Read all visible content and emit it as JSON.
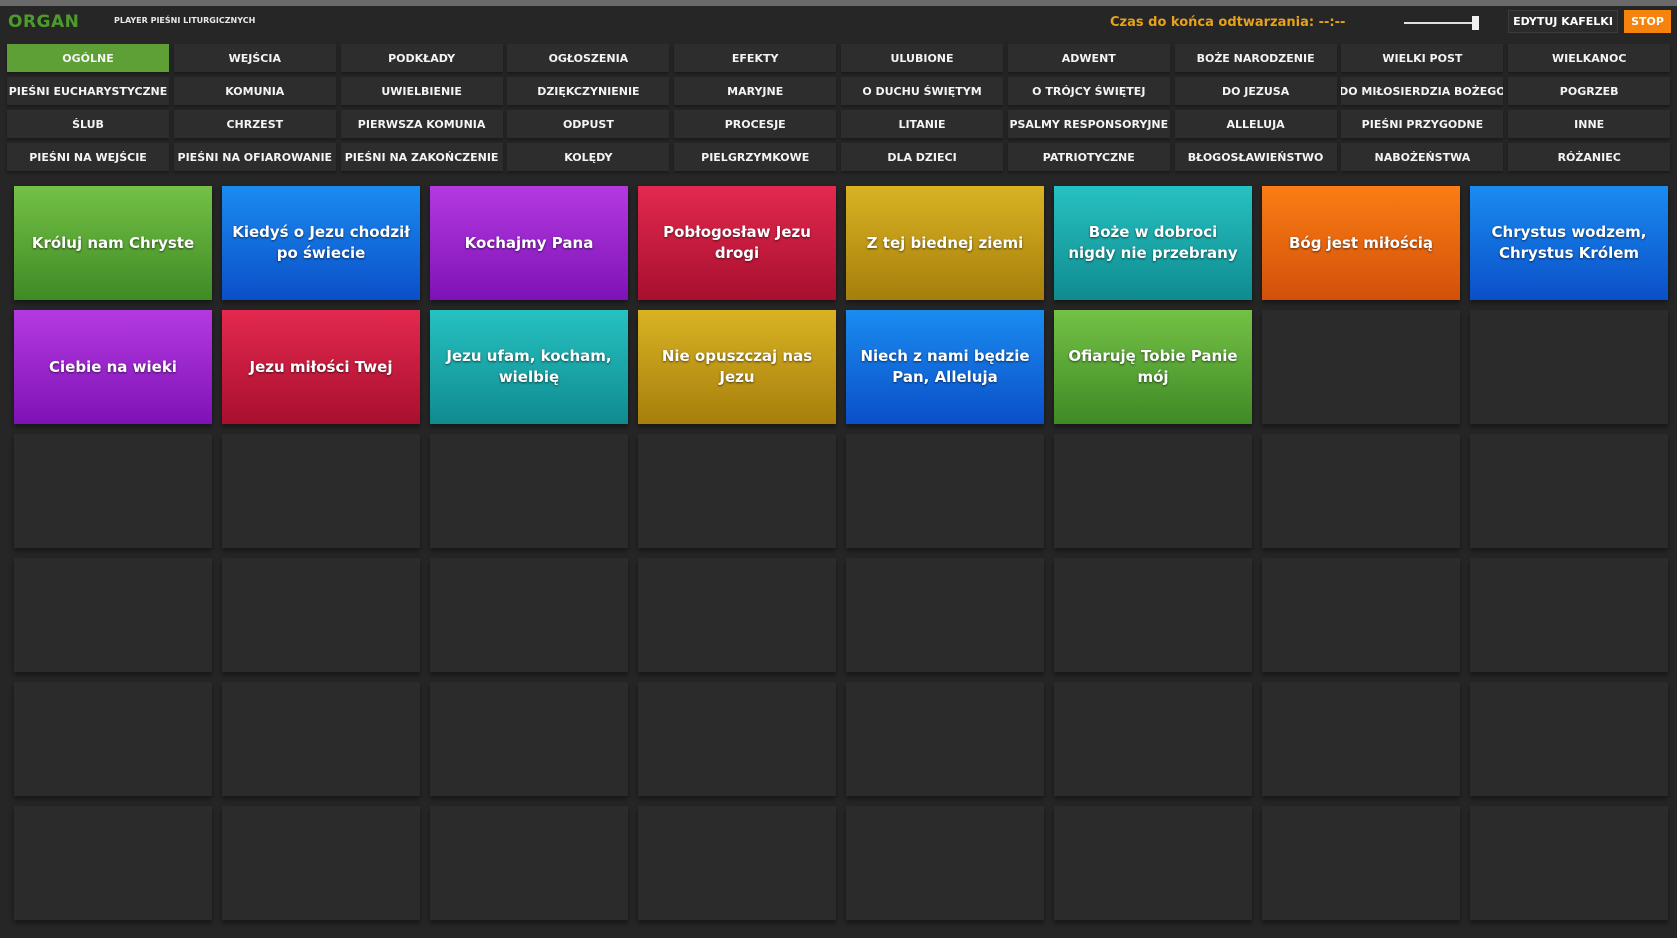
{
  "app": {
    "title": "ORGAN",
    "subtitle": "PLAYER PIEŚNI LITURGICZNYCH",
    "timer_label": "Czas do końca odtwarzania: --:--",
    "edit_button": "EDYTUJ KAFELKI",
    "stop_button": "STOP",
    "accent_color": "#5ea036",
    "timer_color": "#e6a21a",
    "stop_color": "#f5830d"
  },
  "categories": [
    {
      "label": "OGÓLNE",
      "active": true
    },
    {
      "label": "WEJŚCIA"
    },
    {
      "label": "PODKŁADY"
    },
    {
      "label": "OGŁOSZENIA"
    },
    {
      "label": "EFEKTY"
    },
    {
      "label": "ULUBIONE"
    },
    {
      "label": "ADWENT"
    },
    {
      "label": "BOŻE NARODZENIE"
    },
    {
      "label": "WIELKI POST"
    },
    {
      "label": "WIELKANOC"
    },
    {
      "label": "PIEŚNI EUCHARYSTYCZNE"
    },
    {
      "label": "KOMUNIA"
    },
    {
      "label": "UWIELBIENIE"
    },
    {
      "label": "DZIĘKCZYNIENIE"
    },
    {
      "label": "MARYJNE"
    },
    {
      "label": "O DUCHU ŚWIĘTYM"
    },
    {
      "label": "O TRÓJCY ŚWIĘTEJ"
    },
    {
      "label": "DO JEZUSA"
    },
    {
      "label": "DO MIŁOSIERDZIA BOŻEGO"
    },
    {
      "label": "POGRZEB"
    },
    {
      "label": "ŚLUB"
    },
    {
      "label": "CHRZEST"
    },
    {
      "label": "PIERWSZA KOMUNIA"
    },
    {
      "label": "ODPUST"
    },
    {
      "label": "PROCESJE"
    },
    {
      "label": "LITANIE"
    },
    {
      "label": "PSALMY RESPONSORYJNE"
    },
    {
      "label": "ALLELUJA"
    },
    {
      "label": "PIEŚNI PRZYGODNE"
    },
    {
      "label": "INNE"
    },
    {
      "label": "PIEŚNI NA WEJŚCIE"
    },
    {
      "label": "PIEŚNI NA OFIAROWANIE"
    },
    {
      "label": "PIEŚNI NA ZAKOŃCZENIE"
    },
    {
      "label": "KOLĘDY"
    },
    {
      "label": "PIELGRZYMKOWE"
    },
    {
      "label": "DLA DZIECI"
    },
    {
      "label": "PATRIOTYCZNE"
    },
    {
      "label": "BŁOGOSŁAWIEŃSTWO"
    },
    {
      "label": "NABOŻEŃSTWA"
    },
    {
      "label": "RÓŻANIEC"
    }
  ],
  "tiles": [
    {
      "label": "Króluj nam Chryste",
      "color": "green"
    },
    {
      "label": "Kiedyś o Jezu chodził po świecie",
      "color": "blue"
    },
    {
      "label": "Kochajmy Pana",
      "color": "purple"
    },
    {
      "label": "Pobłogosław Jezu drogi",
      "color": "red"
    },
    {
      "label": "Z tej biednej ziemi",
      "color": "gold"
    },
    {
      "label": "Boże w dobroci nigdy nie przebrany",
      "color": "teal"
    },
    {
      "label": "Bóg jest miłością",
      "color": "orange"
    },
    {
      "label": "Chrystus wodzem, Chrystus Królem",
      "color": "blue"
    },
    {
      "label": "Ciebie na wieki",
      "color": "purple"
    },
    {
      "label": "Jezu miłości Twej",
      "color": "red"
    },
    {
      "label": "Jezu ufam, kocham, wielbię",
      "color": "teal"
    },
    {
      "label": "Nie opuszczaj nas Jezu",
      "color": "gold"
    },
    {
      "label": "Niech z nami będzie Pan, Alleluja",
      "color": "blue"
    },
    {
      "label": "Ofiaruję Tobie Panie mój",
      "color": "green"
    },
    {
      "label": "",
      "color": "empty"
    },
    {
      "label": "",
      "color": "empty"
    },
    {
      "label": "",
      "color": "empty"
    },
    {
      "label": "",
      "color": "empty"
    },
    {
      "label": "",
      "color": "empty"
    },
    {
      "label": "",
      "color": "empty"
    },
    {
      "label": "",
      "color": "empty"
    },
    {
      "label": "",
      "color": "empty"
    },
    {
      "label": "",
      "color": "empty"
    },
    {
      "label": "",
      "color": "empty"
    },
    {
      "label": "",
      "color": "empty"
    },
    {
      "label": "",
      "color": "empty"
    },
    {
      "label": "",
      "color": "empty"
    },
    {
      "label": "",
      "color": "empty"
    },
    {
      "label": "",
      "color": "empty"
    },
    {
      "label": "",
      "color": "empty"
    },
    {
      "label": "",
      "color": "empty"
    },
    {
      "label": "",
      "color": "empty"
    },
    {
      "label": "",
      "color": "empty"
    },
    {
      "label": "",
      "color": "empty"
    },
    {
      "label": "",
      "color": "empty"
    },
    {
      "label": "",
      "color": "empty"
    },
    {
      "label": "",
      "color": "empty"
    },
    {
      "label": "",
      "color": "empty"
    },
    {
      "label": "",
      "color": "empty"
    },
    {
      "label": "",
      "color": "empty"
    },
    {
      "label": "",
      "color": "empty"
    },
    {
      "label": "",
      "color": "empty"
    },
    {
      "label": "",
      "color": "empty"
    },
    {
      "label": "",
      "color": "empty"
    },
    {
      "label": "",
      "color": "empty"
    },
    {
      "label": "",
      "color": "empty"
    },
    {
      "label": "",
      "color": "empty"
    },
    {
      "label": "",
      "color": "empty"
    }
  ],
  "tile_colors": {
    "green": [
      "#74c146",
      "#3f8a25"
    ],
    "blue": [
      "#1a8cf0",
      "#0b4fc8"
    ],
    "purple": [
      "#b43ae0",
      "#7e12b6"
    ],
    "red": [
      "#e3294f",
      "#a80f2e"
    ],
    "gold": [
      "#d9b323",
      "#a67e0c"
    ],
    "teal": [
      "#27c1c1",
      "#0f8b8f"
    ],
    "orange": [
      "#fb7d14",
      "#d2500a"
    ],
    "empty": [
      "#2b2b2b",
      "#2b2b2b"
    ]
  }
}
